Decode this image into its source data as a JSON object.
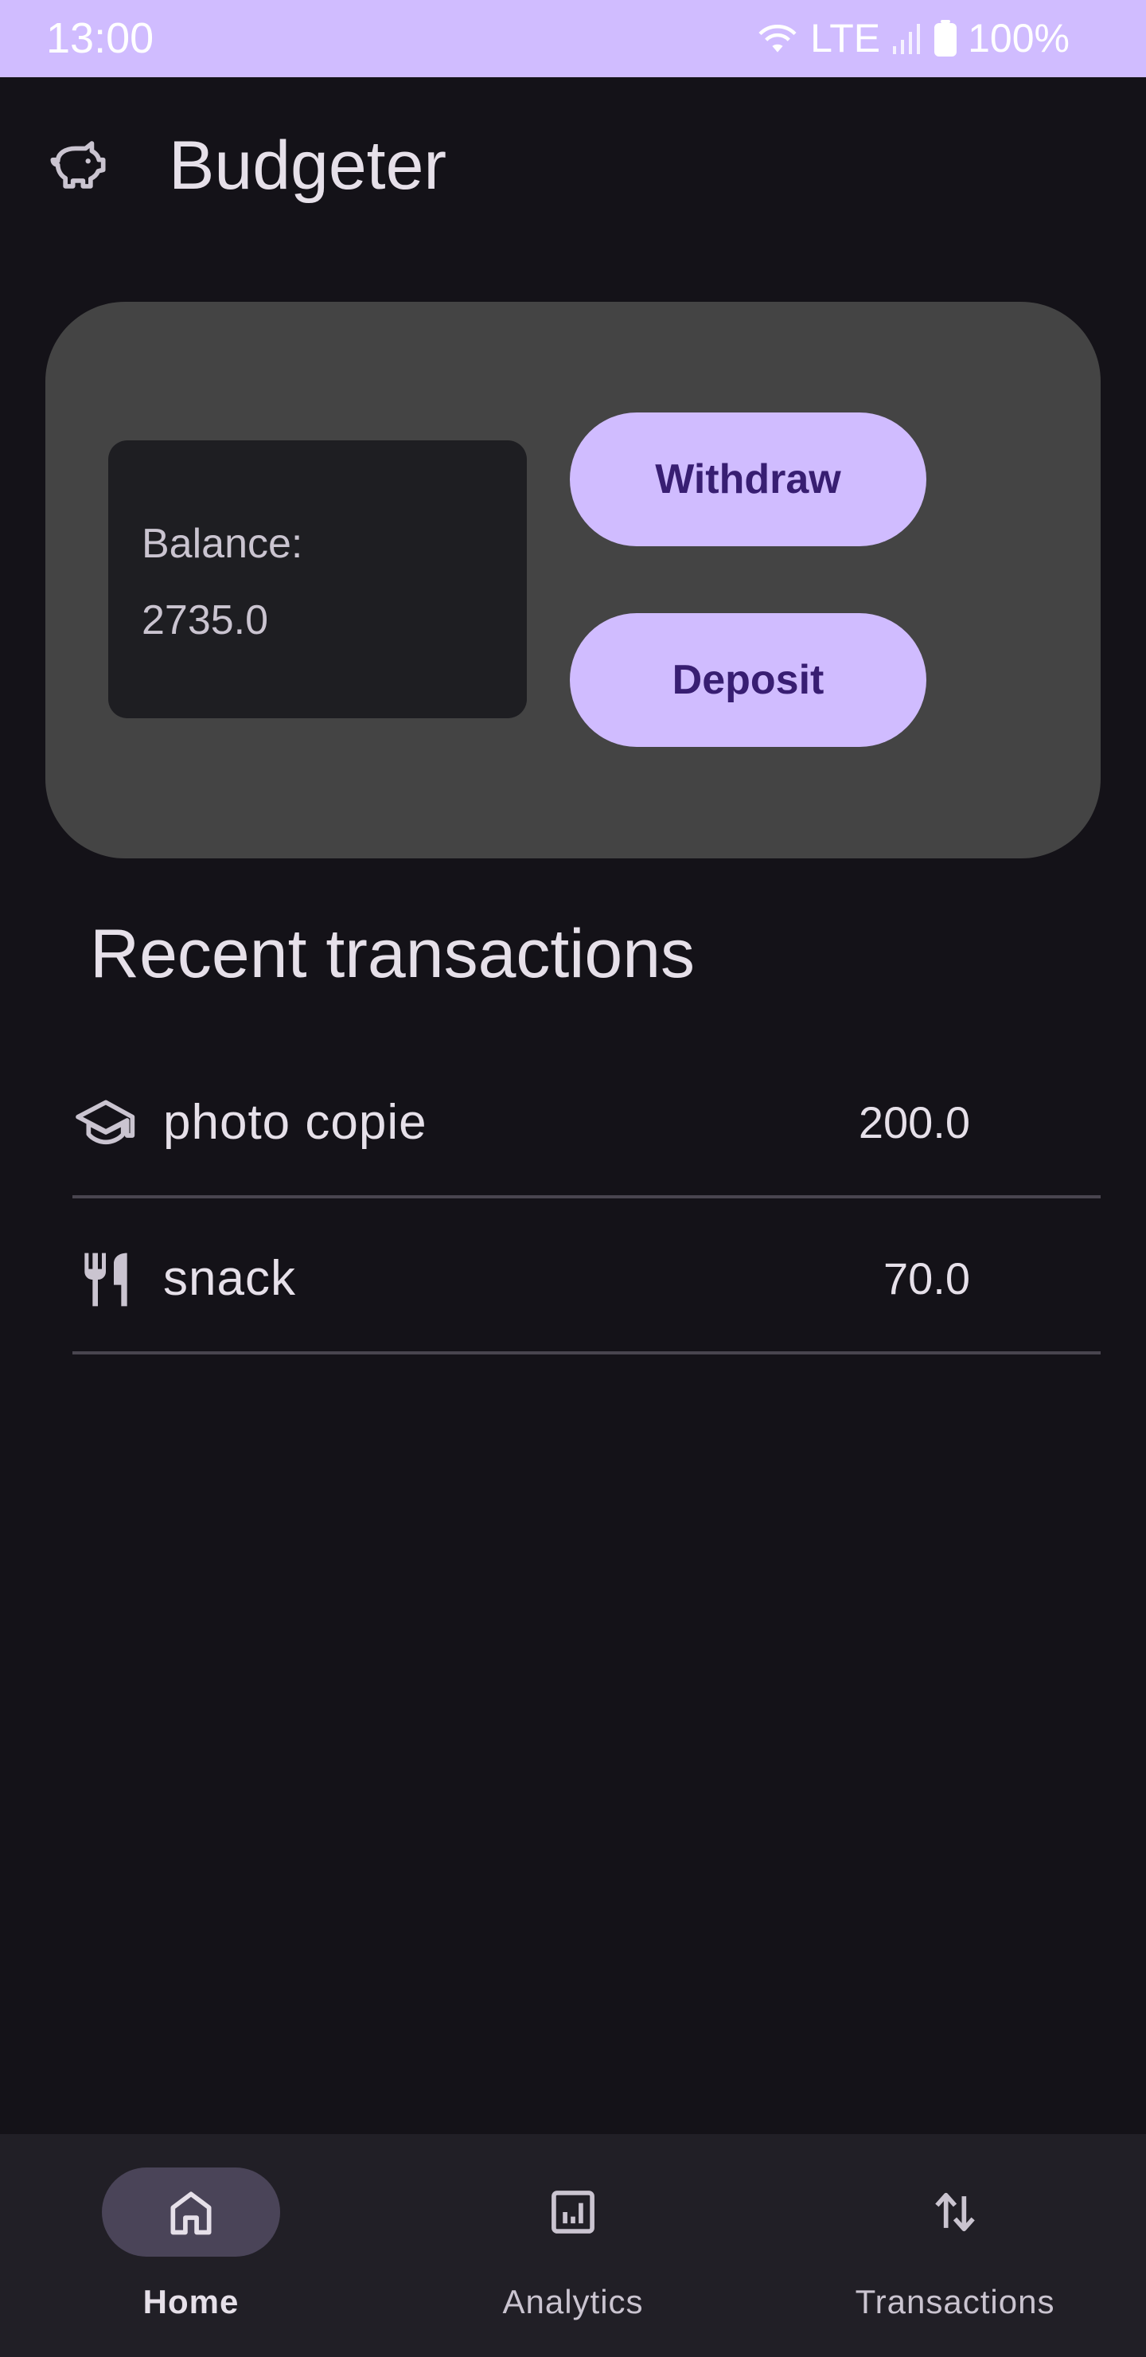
{
  "status_bar": {
    "time": "13:00",
    "network": "LTE",
    "battery": "100%",
    "icons": [
      "wifi-icon",
      "signal-icon",
      "battery-icon"
    ]
  },
  "app_bar": {
    "title": "Budgeter",
    "icon": "piggy-bank-icon"
  },
  "balance_card": {
    "label": "Balance:",
    "value": "2735.0",
    "withdraw_label": "Withdraw",
    "deposit_label": "Deposit"
  },
  "recent": {
    "title": "Recent transactions",
    "items": [
      {
        "icon": "graduation-cap-icon",
        "name": "photo copie",
        "amount": "200.0"
      },
      {
        "icon": "restaurant-icon",
        "name": "snack",
        "amount": "70.0"
      }
    ]
  },
  "bottom_nav": {
    "items": [
      {
        "label": "Home",
        "icon": "home-icon",
        "active": true
      },
      {
        "label": "Analytics",
        "icon": "analytics-icon",
        "active": false
      },
      {
        "label": "Transactions",
        "icon": "swap-vert-icon",
        "active": false
      }
    ]
  },
  "colors": {
    "background": "#141218",
    "accent": "#D0BCFF",
    "card": "#444444",
    "button_text": "#381E72",
    "nav_background": "#211F26",
    "nav_indicator": "#4A4458"
  }
}
